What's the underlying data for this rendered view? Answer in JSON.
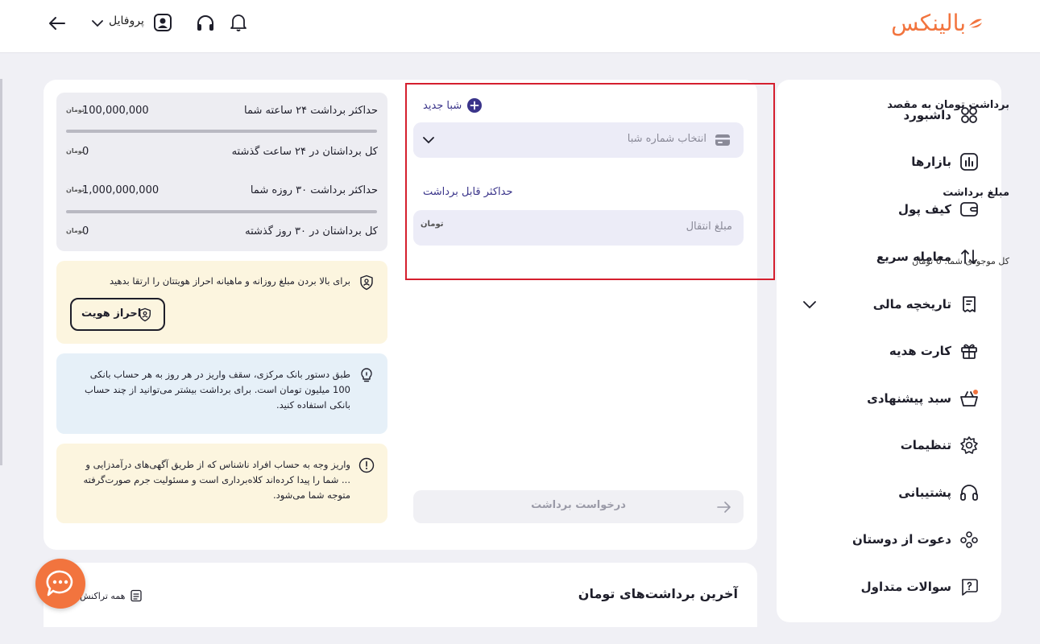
{
  "header": {
    "logo_text": "بالینکس",
    "profile_label": "پروفایل"
  },
  "sidebar": {
    "items": [
      {
        "label": "داشبورد",
        "icon": "dashboard-icon"
      },
      {
        "label": "بازارها",
        "icon": "markets-icon"
      },
      {
        "label": "کیف پول",
        "icon": "wallet-icon"
      },
      {
        "label": "معامله سریع",
        "icon": "swap-icon"
      },
      {
        "label": "تاریخچه مالی",
        "icon": "receipt-icon"
      },
      {
        "label": "کارت هدیه",
        "icon": "gift-icon"
      },
      {
        "label": "سبد پیشنهادی",
        "icon": "basket-icon"
      },
      {
        "label": "تنظیمات",
        "icon": "gear-icon"
      },
      {
        "label": "پشتیبانی",
        "icon": "headset-icon"
      },
      {
        "label": "دعوت از دوستان",
        "icon": "users-icon"
      },
      {
        "label": "سوالات متداول",
        "icon": "question-icon"
      }
    ]
  },
  "withdraw": {
    "title": "برداشت تومان به مقصد",
    "new_sheba": "شبا جدید",
    "sheba_placeholder": "انتخاب شماره شبا",
    "amount_label": "مبلغ برداشت",
    "max_link": "حداکثر قابل برداشت",
    "amount_placeholder": "مبلغ انتقال",
    "toman_glyph": "تومان",
    "balance_text": "کل موجودی شما: 0 تومان",
    "submit_label": "درخواست برداشت"
  },
  "limits": [
    {
      "label": "حداکثر برداشت ۲۴ ساعته شما",
      "value": "100,000,000",
      "unit": "تومان",
      "used_fraction": 0
    },
    {
      "label": "کل برداشتان در ۲۴ ساعت گذشته",
      "value": "0",
      "unit": "تومان"
    },
    {
      "label": "حداکثر برداشت ۳۰ روزه شما",
      "value": "1,000,000,000",
      "unit": "تومان",
      "used_fraction": 0
    },
    {
      "label": "کل برداشتان در ۳۰ روز گذشته",
      "value": "0",
      "unit": "تومان"
    }
  ],
  "notices": {
    "kyc": {
      "text": "برای بالا بردن مبلغ روزانه و ماهیانه احراز هویتتان را ارتقا بدهید",
      "button": "احراز هویت",
      "bg": "#fcf5df"
    },
    "bank": {
      "text": "طبق دستور بانک مرکزی، سقف واریز در هر روز به هر حساب بانکی 100 میلیون تومان است. برای برداشت بیشتر می‌توانید از چند حساب بانکی استفاده کنید.",
      "bg": "#e6f0f8"
    },
    "warning": {
      "text": "واریز وجه به حساب افراد ناشناس که از طریق آگهی‌های درآمدزایی و ... شما را پیدا کرده‌اند کلاه‌برداری است و مسئولیت جرم صورت‌گرفته متوجه شما می‌شود.",
      "bg": "#fcf5df"
    }
  },
  "recent": {
    "title": "آخرین برداشت‌های تومان",
    "all_transactions": "همه تراکنش‌ها"
  },
  "colors": {
    "brand": "#f2743e",
    "accent": "#3a348a",
    "highlight_border": "#d51f2e"
  }
}
